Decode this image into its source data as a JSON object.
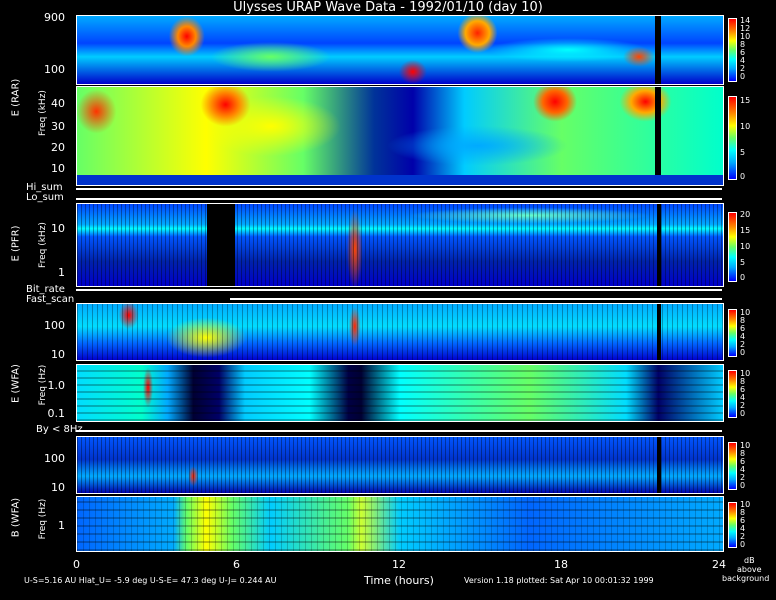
{
  "chart_data": [
    {
      "type": "heatmap",
      "title": "Ulysses URAP Wave Data - 1992/01/10 (day 10)",
      "panel": "E (RAR)",
      "ylabel": "Freq (kHz)",
      "y_ticks_upper": [
        "900",
        "100"
      ],
      "y_ticks_lower": [
        "40",
        "30",
        "20",
        "10"
      ],
      "colorbar_ticks_upper": [
        "14",
        "12",
        "10",
        "8",
        "6",
        "4",
        "2",
        "0"
      ],
      "colorbar_ticks_lower": [
        "15",
        "10",
        "5",
        "0"
      ]
    },
    {
      "type": "heatmap",
      "panel": "E (PFR)",
      "ylabel": "Freq (kHz)",
      "y_ticks": [
        "10",
        "1"
      ],
      "colorbar_ticks": [
        "20",
        "15",
        "10",
        "5",
        "0"
      ],
      "flags_above": [
        "Hi_sum",
        "Lo_sum"
      ]
    },
    {
      "type": "heatmap",
      "panel": "E (WFA)",
      "ylabel": "Freq (Hz)",
      "y_ticks_upper": [
        "100",
        "10"
      ],
      "y_ticks_lower": [
        "1.0",
        "0.1"
      ],
      "colorbar_ticks": [
        "10",
        "8",
        "6",
        "4",
        "2",
        "0"
      ],
      "flags_above": [
        "Bit_rate",
        "Fast_scan"
      ]
    },
    {
      "type": "heatmap",
      "panel": "B (WFA)",
      "ylabel": "Freq (Hz)",
      "y_ticks_upper": [
        "100",
        "10"
      ],
      "y_ticks_lower": [
        "1"
      ],
      "colorbar_ticks": [
        "10",
        "8",
        "6",
        "4",
        "2",
        "0"
      ],
      "flags_above": [
        "By < 8Hz"
      ],
      "colorbar_unit": [
        "dB",
        "above",
        "background"
      ]
    }
  ],
  "x_axis": {
    "label": "Time (hours)",
    "range": [
      0,
      24
    ],
    "ticks": [
      "0",
      "6",
      "12",
      "18",
      "24"
    ]
  },
  "footer": {
    "left": "U-S=5.16 AU  Hlat_U= -5.9 deg  U-S-E= 47.3 deg  U-J= 0.244 AU",
    "right": "Version 1.18 plotted: Sat Apr 10 00:01:32 1999"
  },
  "labels": {
    "title": "Ulysses URAP Wave Data - 1992/01/10 (day 10)",
    "rar": "E (RAR)",
    "rar_freq": "Freq (kHz)",
    "pfr": "E (PFR)",
    "pfr_freq": "Freq (kHz)",
    "ewfa": "E (WFA)",
    "ewfa_freq": "Freq (Hz)",
    "bwfa": "B (WFA)",
    "bwfa_freq": "Freq (Hz)",
    "hi_sum": "Hi_sum",
    "lo_sum": "Lo_sum",
    "bit_rate": "Bit_rate",
    "fast_scan": "Fast_scan",
    "by": "By < 8Hz",
    "db": "dB",
    "above": "above",
    "background": "background"
  },
  "colors": {
    "background": "#000000",
    "low": "#0000ff",
    "mid_low": "#00ffff",
    "mid": "#66ff66",
    "mid_high": "#ffff00",
    "high": "#ff0000"
  }
}
